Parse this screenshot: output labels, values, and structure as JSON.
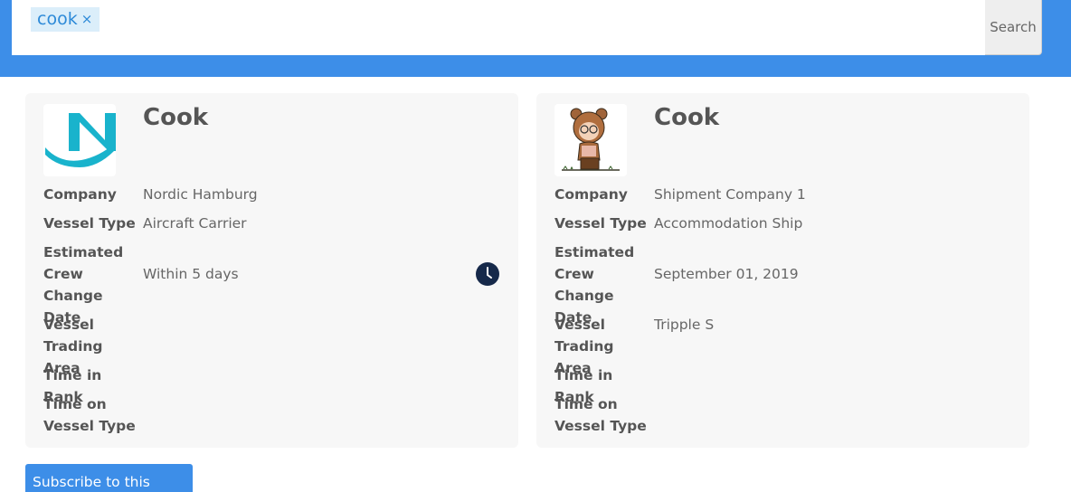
{
  "search": {
    "tags": [
      {
        "label": "cook",
        "remove": "×"
      }
    ],
    "button_label": "Search"
  },
  "results": [
    {
      "title": "Cook",
      "logo": "nordic-hamburg-logo",
      "rows": [
        {
          "label": "Company",
          "value": "Nordic Hamburg"
        },
        {
          "label": "Vessel Type",
          "value": "Aircraft Carrier"
        },
        {
          "label": "Estimated Crew Change Date",
          "value": "Within 5 days"
        },
        {
          "label": "Vessel Trading Area",
          "value": ""
        },
        {
          "label": "Time in Rank",
          "value": ""
        },
        {
          "label": "Time on Vessel Type",
          "value": ""
        }
      ],
      "status_icon": "clock-icon"
    },
    {
      "title": "Cook",
      "logo": "bear-costume-avatar",
      "rows": [
        {
          "label": "Company",
          "value": "Shipment Company 1"
        },
        {
          "label": "Vessel Type",
          "value": "Accommodation Ship"
        },
        {
          "label": "Estimated Crew Change Date",
          "value": "September 01, 2019"
        },
        {
          "label": "Vessel Trading Area",
          "value": "Tripple S"
        },
        {
          "label": "Time in Rank",
          "value": ""
        },
        {
          "label": "Time on Vessel Type",
          "value": ""
        }
      ]
    }
  ],
  "subscribe_label": "Subscribe to this search",
  "colors": {
    "accent": "#3d8ee8",
    "card_bg": "#f7f7f7",
    "logo_cyan": "#19b3cc",
    "clock": "#16294a"
  }
}
